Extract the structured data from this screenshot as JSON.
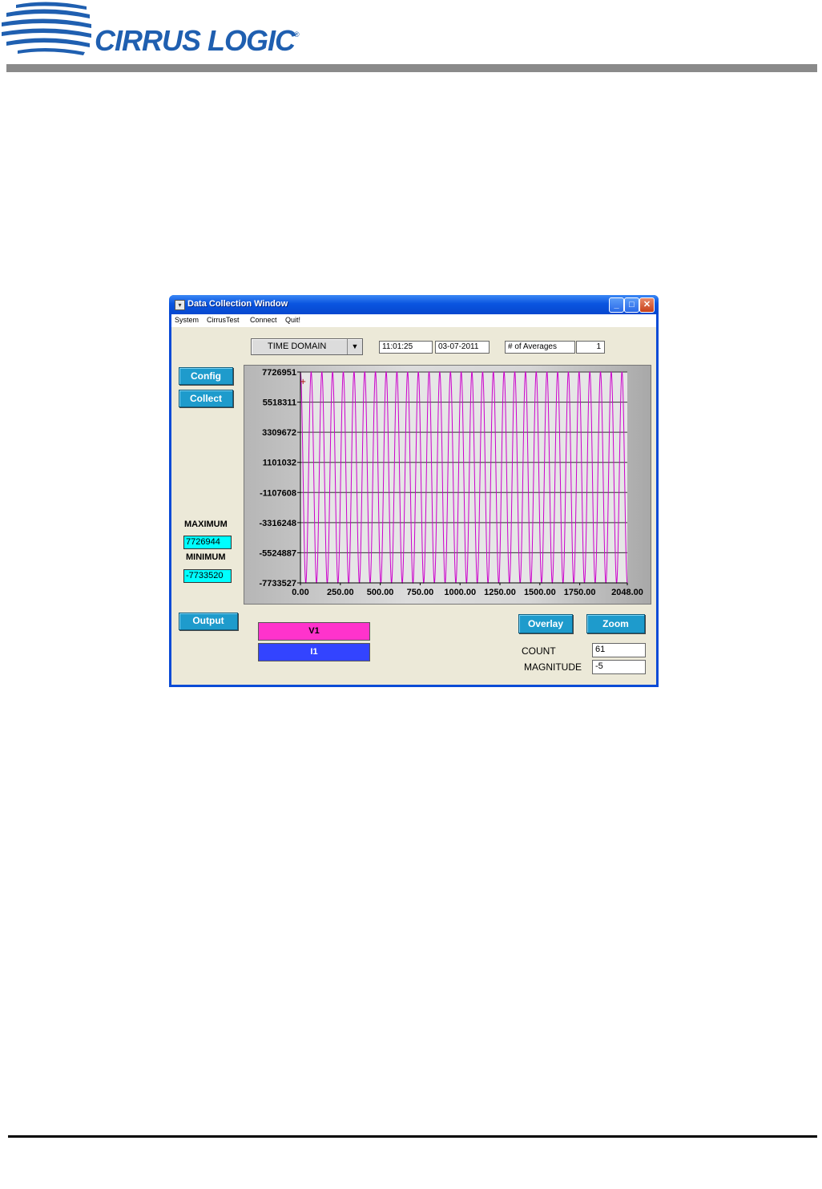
{
  "header": {
    "logo_text": "CIRRUS LOGIC",
    "logo_reg": "®"
  },
  "window": {
    "title": "Data Collection Window",
    "controls": {
      "minimize": "_",
      "maximize": "□",
      "close": "✕"
    }
  },
  "menu": [
    "System",
    "CirrusTest",
    "Connect",
    "Quit!"
  ],
  "toolbar": {
    "mode_selected": "TIME DOMAIN",
    "time": "11:01:25",
    "date": "03-07-2011",
    "averages_label": "# of Averages",
    "averages_value": "1"
  },
  "buttons": {
    "config": "Config",
    "collect": "Collect",
    "output": "Output",
    "overlay": "Overlay",
    "zoom": "Zoom"
  },
  "stats": {
    "max_label": "MAXIMUM",
    "max_value": "7726944",
    "min_label": "MINIMUM",
    "min_value": "-7733520"
  },
  "channels": [
    {
      "label": "V1",
      "color": "#ff33cc"
    },
    {
      "label": "I1",
      "color": "#3344ff"
    }
  ],
  "readouts": {
    "count_label": "COUNT",
    "count_value": "61",
    "magnitude_label": "MAGNITUDE",
    "magnitude_value": "-5"
  },
  "icons": [
    "window-app-icon",
    "dropdown-arrow-icon",
    "minimize-icon",
    "maximize-icon",
    "close-icon",
    "cirrus-logic-logo"
  ],
  "colors": {
    "trace": "#cc00cc",
    "accent_button": "#1e9bcc",
    "title_bar": "#0a55e0"
  },
  "chart_data": {
    "type": "line",
    "title": "",
    "xlabel": "",
    "ylabel": "",
    "xlim": [
      0,
      2048
    ],
    "ylim": [
      -7733527,
      7726951
    ],
    "x_ticks": [
      "0.00",
      "250.00",
      "500.00",
      "750.00",
      "1000.00",
      "1250.00",
      "1500.00",
      "1750.00",
      "2048.00"
    ],
    "y_ticks": [
      "7726951",
      "5518311",
      "3309672",
      "1101032",
      "-1107608",
      "-3316248",
      "-5524887",
      "-7733527"
    ],
    "grid": "horizontal",
    "series": [
      {
        "name": "V1",
        "color": "#cc00cc",
        "cycles": 30.5,
        "amplitude_max": 7726944,
        "amplitude_min": -7733520
      }
    ]
  }
}
